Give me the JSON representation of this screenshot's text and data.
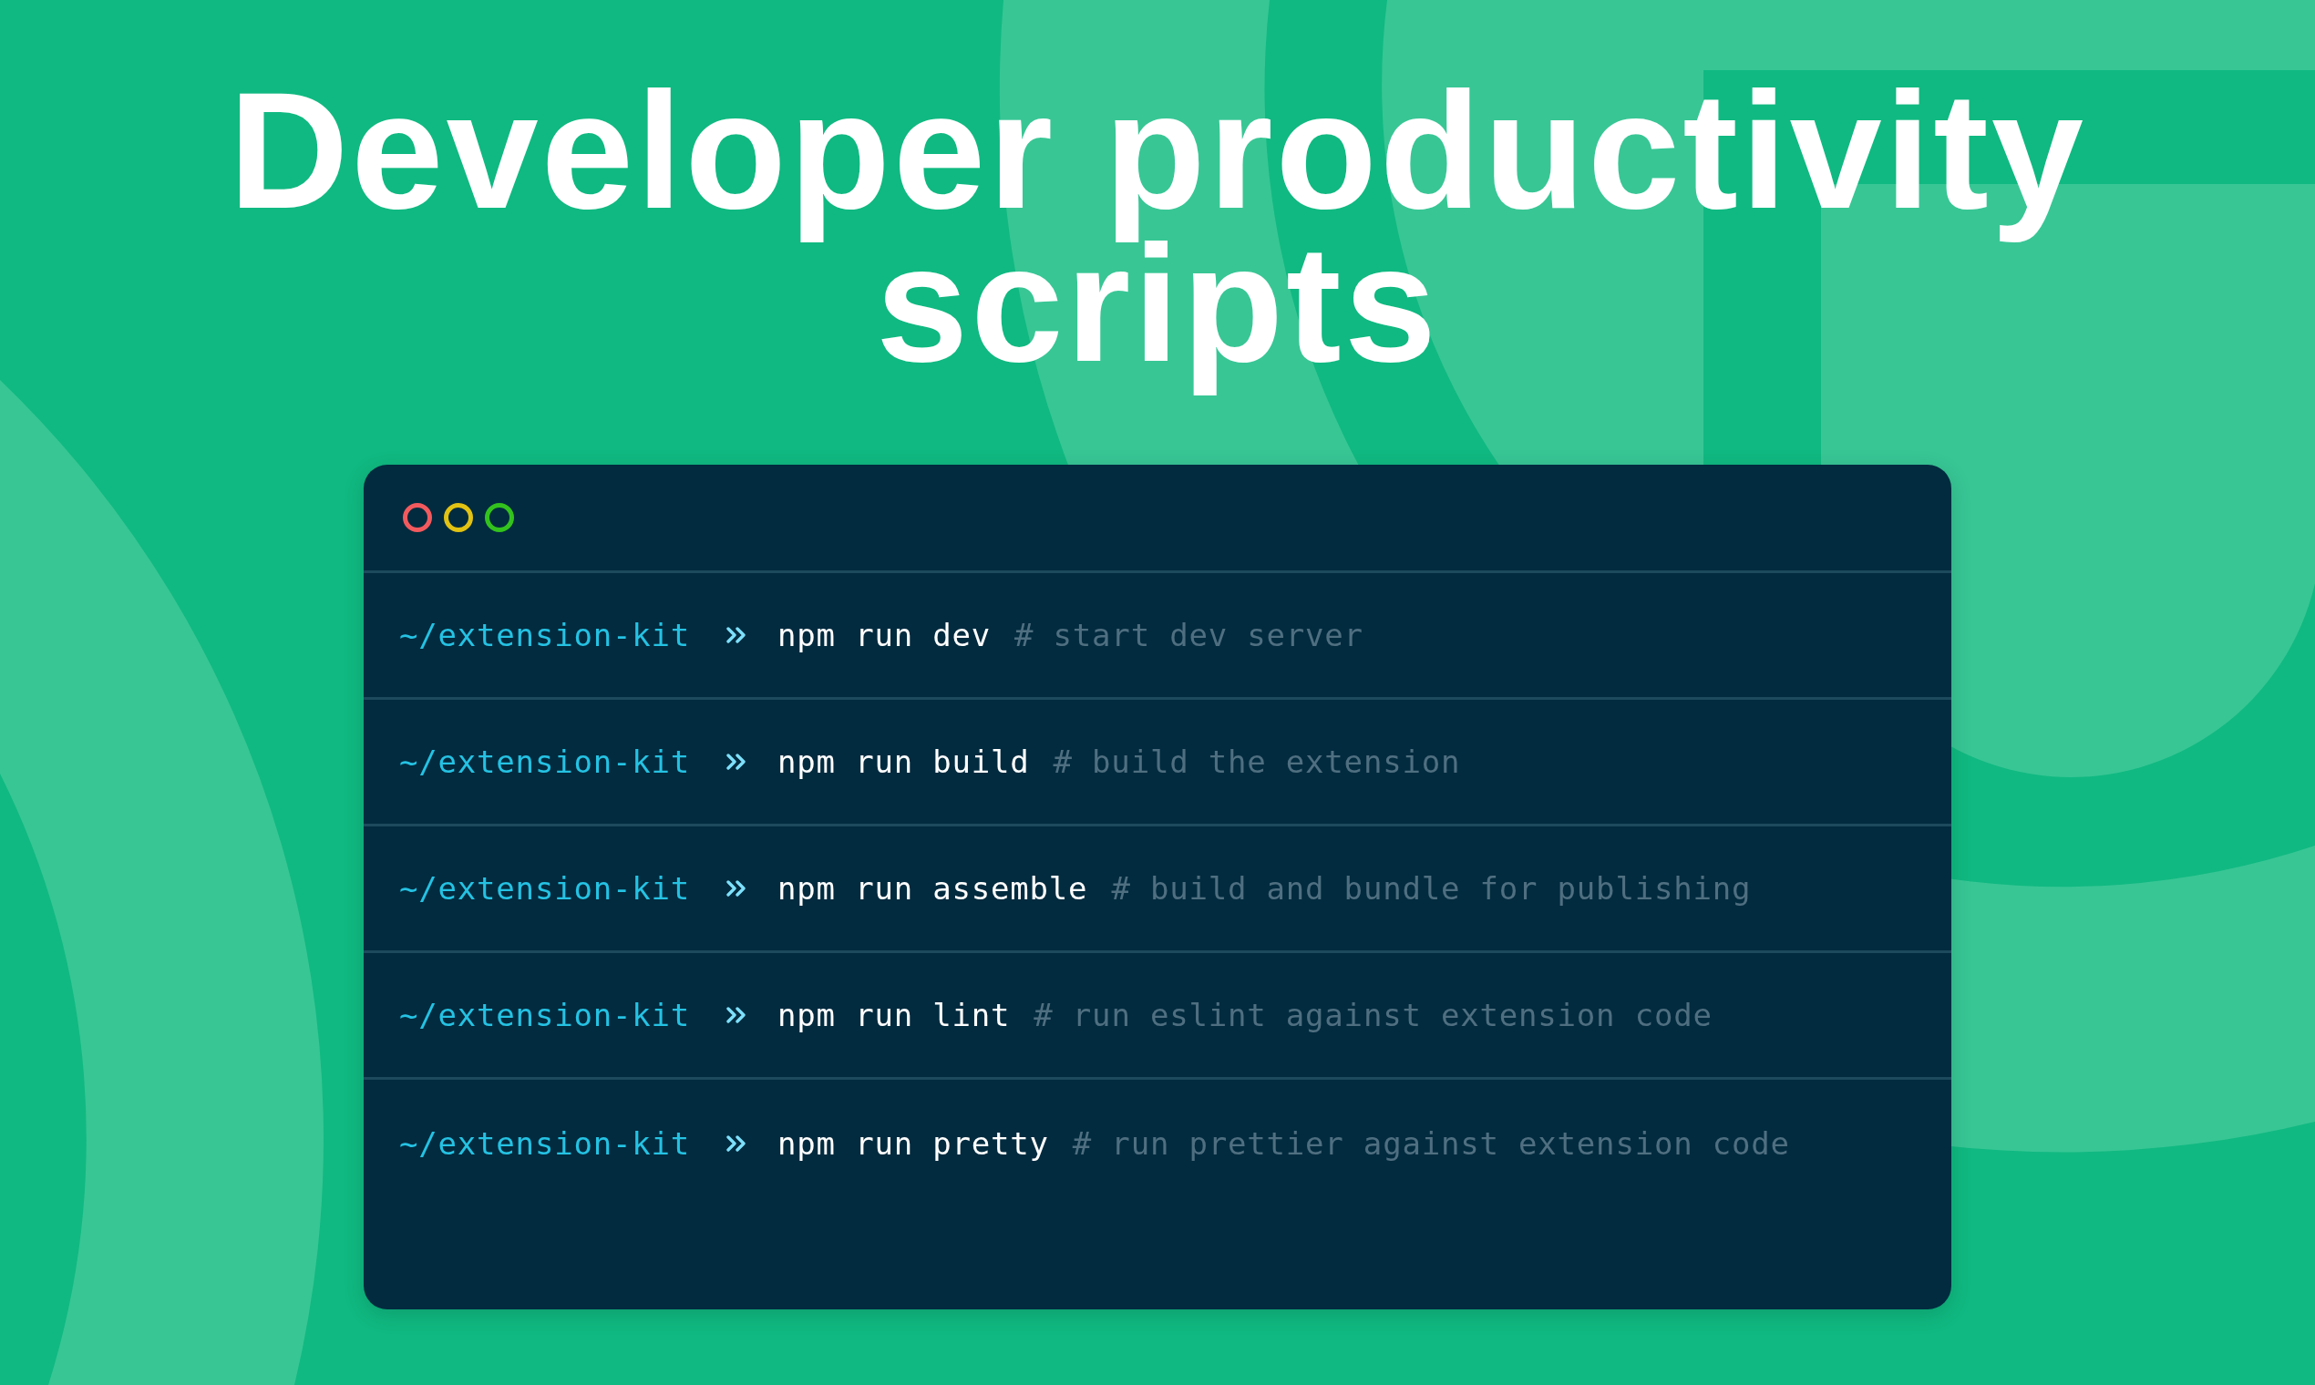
{
  "title": "Developer productivity scripts",
  "terminal": {
    "window_controls": [
      {
        "color": "#f25a5e"
      },
      {
        "color": "#e2c212"
      },
      {
        "color": "#33c21d"
      }
    ],
    "lines": [
      {
        "path": "~/extension-kit",
        "command": "npm run dev",
        "comment": "# start dev server"
      },
      {
        "path": "~/extension-kit",
        "command": "npm run build",
        "comment": "# build the extension"
      },
      {
        "path": "~/extension-kit",
        "command": "npm run assemble",
        "comment": "# build and bundle for publishing"
      },
      {
        "path": "~/extension-kit",
        "command": "npm run lint",
        "comment": "# run eslint against extension code"
      },
      {
        "path": "~/extension-kit",
        "command": "npm run pretty",
        "comment": "# run prettier against extension code"
      }
    ]
  }
}
